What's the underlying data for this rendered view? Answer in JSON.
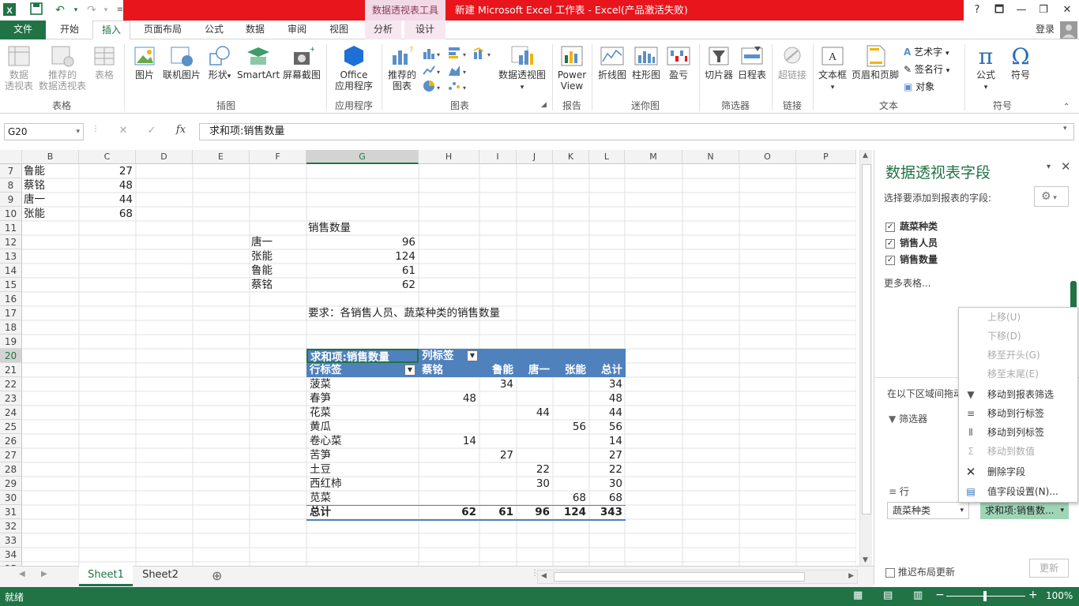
{
  "window": {
    "title": "新建 Microsoft Excel 工作表 - Excel(产品激活失败)",
    "context_tab_group": "数据透视表工具",
    "login": "登录",
    "help": "?",
    "controls": [
      "🗖",
      "—",
      "❐",
      "✕"
    ]
  },
  "tabs": {
    "file": "文件",
    "home": "开始",
    "insert": "插入",
    "layout": "页面布局",
    "formulas": "公式",
    "data": "数据",
    "review": "审阅",
    "view": "视图",
    "analyze": "分析",
    "design": "设计"
  },
  "ribbon": {
    "groups": {
      "tables": "表格",
      "illustrations": "插图",
      "apps": "应用程序",
      "charts": "图表",
      "reports": "报告",
      "sparklines": "迷你图",
      "filters": "筛选器",
      "links": "链接",
      "text": "文本",
      "symbols": "符号"
    },
    "buttons": {
      "pivot_line1": "数据",
      "pivot_line2": "透视表",
      "rec_pivot_line1": "推荐的",
      "rec_pivot_line2": "数据透视表",
      "table": "表格",
      "picture": "图片",
      "online_picture": "联机图片",
      "shapes": "形状",
      "smartart": "SmartArt",
      "screenshot": "屏幕截图",
      "office_line1": "Office",
      "office_line2": "应用程序",
      "rec_charts_line1": "推荐的",
      "rec_charts_line2": "图表",
      "pivot_chart": "数据透视图",
      "power_line1": "Power",
      "power_line2": "View",
      "spark_line": "折线图",
      "spark_column": "柱形图",
      "spark_winloss": "盈亏",
      "slicer": "切片器",
      "timeline": "日程表",
      "hyperlink": "超链接",
      "textbox": "文本框",
      "header_footer": "页眉和页脚",
      "wordart": "艺术字",
      "signature": "签名行",
      "object": "对象",
      "equation": "公式",
      "symbol": "符号"
    }
  },
  "formula_bar": {
    "name_box": "G20",
    "formula": "求和项:销售数量",
    "cancel": "✕",
    "enter": "✓",
    "fx": "fx"
  },
  "grid": {
    "columns": [
      "B",
      "C",
      "D",
      "E",
      "F",
      "G",
      "H",
      "I",
      "J",
      "K",
      "L",
      "M",
      "N",
      "O",
      "P"
    ],
    "rows": [
      "7",
      "8",
      "9",
      "10",
      "11",
      "12",
      "13",
      "14",
      "15",
      "16",
      "17",
      "18",
      "19",
      "20",
      "21",
      "22",
      "23",
      "24",
      "25",
      "26",
      "27",
      "28",
      "29",
      "30",
      "31",
      "32",
      "33",
      "34",
      "35"
    ],
    "source": [
      {
        "name": "鲁能",
        "value": "27"
      },
      {
        "name": "蔡铭",
        "value": "48"
      },
      {
        "name": "唐一",
        "value": "44"
      },
      {
        "name": "张能",
        "value": "68"
      }
    ],
    "summary_header": "销售数量",
    "summary": [
      {
        "name": "唐一",
        "value": "96"
      },
      {
        "name": "张能",
        "value": "124"
      },
      {
        "name": "鲁能",
        "value": "61"
      },
      {
        "name": "蔡铭",
        "value": "62"
      }
    ],
    "requirement": "要求：各销售人员、蔬菜种类的销售数量"
  },
  "pivot": {
    "value_label": "求和项:销售数量",
    "col_label": "列标签",
    "row_label": "行标签",
    "columns": [
      "蔡铭",
      "鲁能",
      "唐一",
      "张能",
      "总计"
    ],
    "rows": [
      {
        "label": "菠菜",
        "cells": [
          "",
          "34",
          "",
          "",
          "34"
        ]
      },
      {
        "label": "春笋",
        "cells": [
          "48",
          "",
          "",
          "",
          "48"
        ]
      },
      {
        "label": "花菜",
        "cells": [
          "",
          "",
          "44",
          "",
          "44"
        ]
      },
      {
        "label": "黄瓜",
        "cells": [
          "",
          "",
          "",
          "56",
          "56"
        ]
      },
      {
        "label": "卷心菜",
        "cells": [
          "14",
          "",
          "",
          "",
          "14"
        ]
      },
      {
        "label": "苦笋",
        "cells": [
          "",
          "27",
          "",
          "",
          "27"
        ]
      },
      {
        "label": "土豆",
        "cells": [
          "",
          "",
          "22",
          "",
          "22"
        ]
      },
      {
        "label": "西红柿",
        "cells": [
          "",
          "",
          "30",
          "",
          "30"
        ]
      },
      {
        "label": "苋菜",
        "cells": [
          "",
          "",
          "",
          "68",
          "68"
        ]
      }
    ],
    "total": {
      "label": "总计",
      "cells": [
        "62",
        "61",
        "96",
        "124",
        "343"
      ]
    }
  },
  "panel": {
    "title": "数据透视表字段",
    "subtitle": "选择要添加到报表的字段:",
    "fields": [
      "蔬菜种类",
      "销售人员",
      "销售数量"
    ],
    "more_tables": "更多表格...",
    "drag_hint": "在以下区域间拖动",
    "filters_label": "筛选器",
    "rows_label": "行",
    "row_field": "蔬菜种类",
    "value_field": "求和项:销售数...",
    "defer": "推迟布局更新",
    "update": "更新"
  },
  "context_menu": {
    "items": [
      {
        "label": "上移(U)",
        "enabled": false,
        "icon": ""
      },
      {
        "label": "下移(D)",
        "enabled": false,
        "icon": ""
      },
      {
        "label": "移至开头(G)",
        "enabled": false,
        "icon": ""
      },
      {
        "label": "移至末尾(E)",
        "enabled": false,
        "icon": ""
      },
      {
        "label": "移动到报表筛选",
        "enabled": true,
        "icon": "filter-icon"
      },
      {
        "label": "移动到行标签",
        "enabled": true,
        "icon": "rows-icon"
      },
      {
        "label": "移动到列标签",
        "enabled": true,
        "icon": "columns-icon"
      },
      {
        "label": "移动到数值",
        "enabled": false,
        "icon": "sigma-icon"
      },
      {
        "label": "删除字段",
        "enabled": true,
        "icon": "delete-icon"
      },
      {
        "label": "值字段设置(N)...",
        "enabled": true,
        "icon": "field-settings-icon"
      }
    ]
  },
  "sheets": {
    "tabs": [
      "Sheet1",
      "Sheet2"
    ],
    "add": "⊕"
  },
  "status": {
    "ready": "就绪",
    "zoom": "100%"
  },
  "colors": {
    "excel_green": "#217346",
    "title_red": "#e8151c",
    "pivot_header": "#4f81bd"
  }
}
